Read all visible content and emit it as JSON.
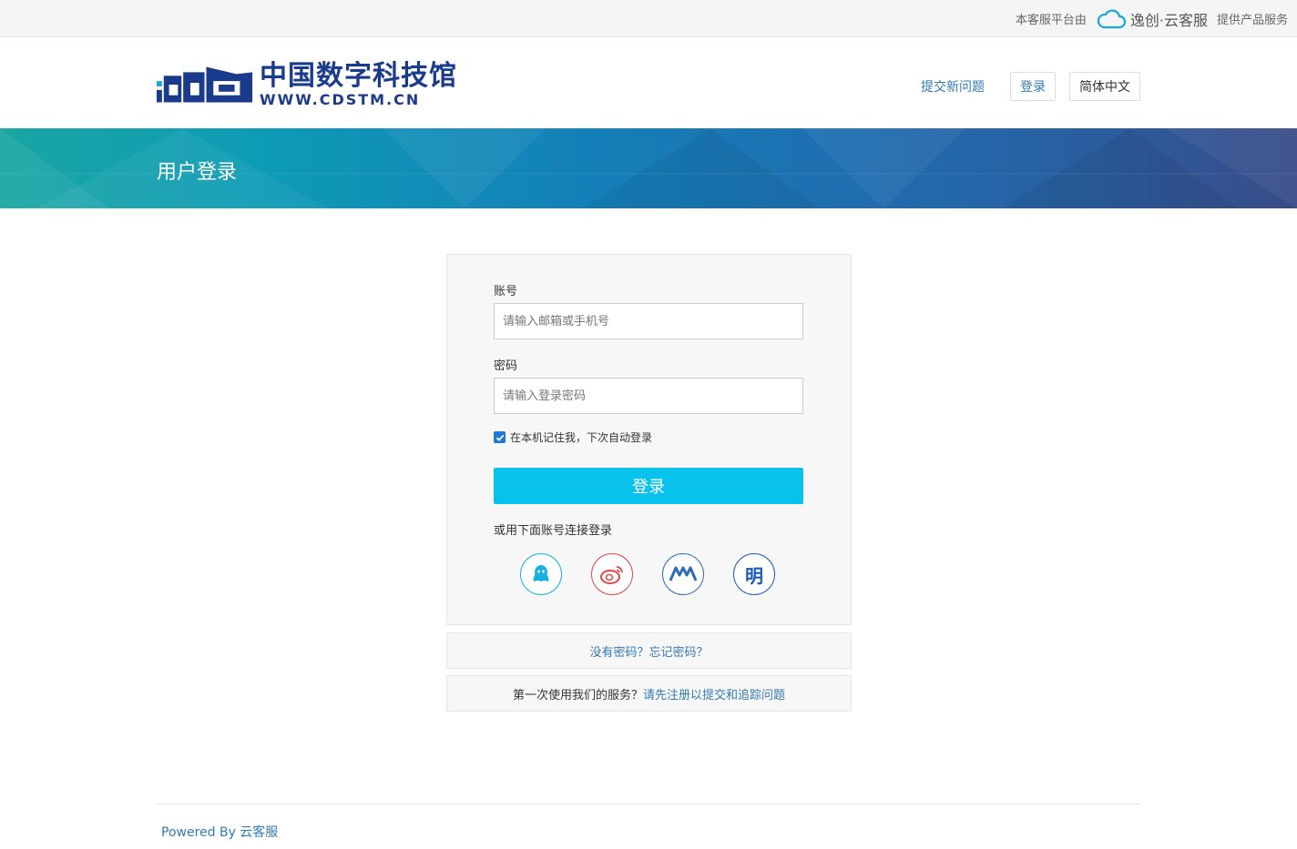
{
  "topbar": {
    "prefix": "本客服平台由",
    "brand": "逸创·云客服",
    "suffix": "提供产品服务"
  },
  "header": {
    "logo_cn": "中国数字科技馆",
    "logo_url": "WWW.CDSTM.CN",
    "nav": {
      "submit_issue": "提交新问题",
      "login": "登录",
      "language": "简体中文"
    }
  },
  "banner": {
    "title": "用户登录"
  },
  "form": {
    "account_label": "账号",
    "account_placeholder": "请输入邮箱或手机号",
    "password_label": "密码",
    "password_placeholder": "请输入登录密码",
    "remember_label": "在本机记住我，下次自动登录",
    "remember_checked": true,
    "submit_label": "登录",
    "social_prompt": "或用下面账号连接登录",
    "socials": [
      {
        "icon": "qq-icon"
      },
      {
        "icon": "weibo-icon"
      },
      {
        "icon": "ww-icon"
      },
      {
        "icon": "ming-icon",
        "text": "明"
      }
    ]
  },
  "links": {
    "forgot": "没有密码？忘记密码？",
    "first_time": "第一次使用我们的服务？",
    "register": "请先注册以提交和追踪问题"
  },
  "footer": {
    "powered_by": "Powered By 云客服"
  },
  "colors": {
    "accent": "#09c2ec",
    "link": "#337ab7",
    "logo": "#1a3a8c"
  }
}
